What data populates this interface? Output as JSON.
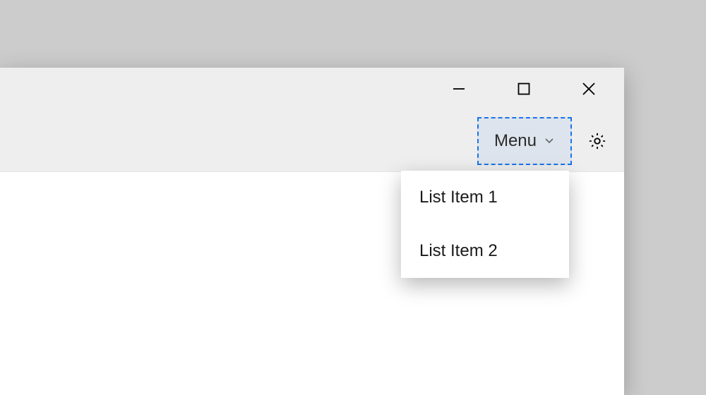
{
  "toolbar": {
    "menu": {
      "label": "Menu"
    }
  },
  "dropdown": {
    "items": [
      {
        "label": "List Item 1"
      },
      {
        "label": "List Item 2"
      }
    ]
  }
}
